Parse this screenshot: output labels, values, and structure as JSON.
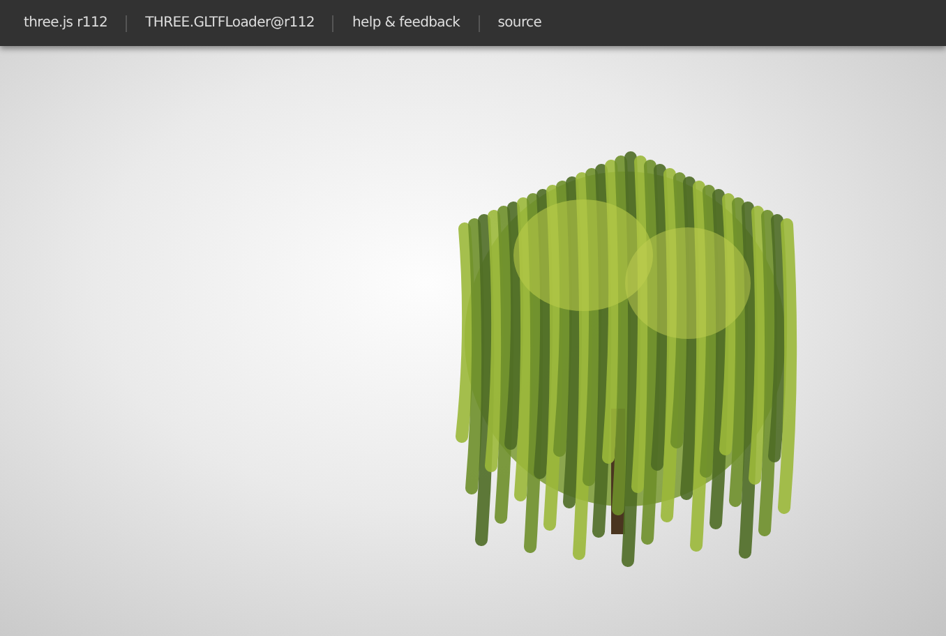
{
  "menu_bar": {
    "links": [
      {
        "label": "three.js r112"
      },
      {
        "label": "THREE.GLTFLoader@r112"
      },
      {
        "label": "help & feedback"
      },
      {
        "label": "source"
      }
    ]
  }
}
